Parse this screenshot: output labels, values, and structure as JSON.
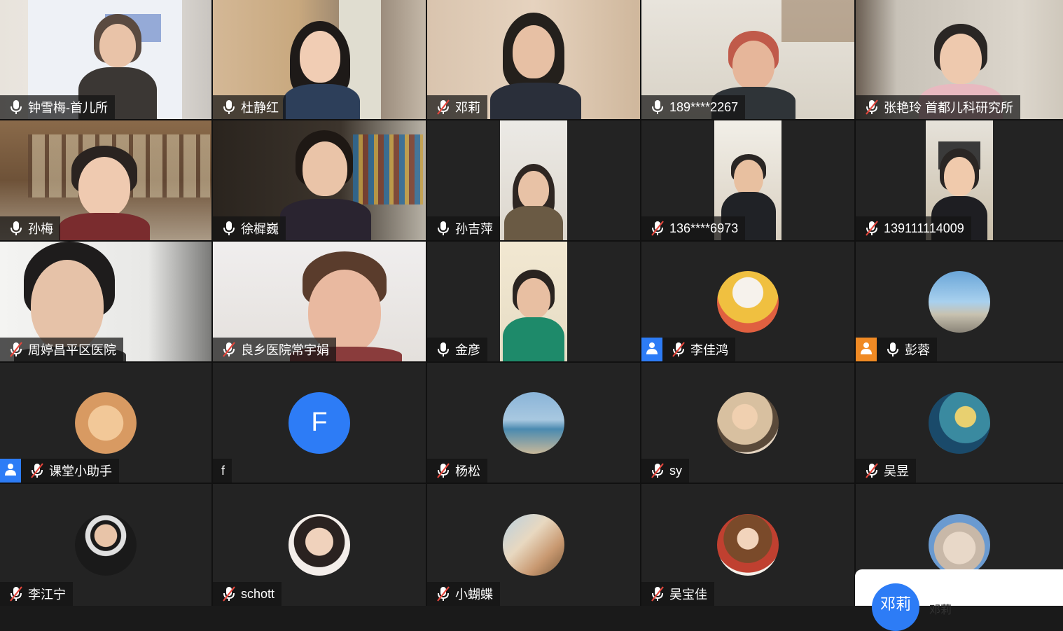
{
  "participants": [
    {
      "name": "钟雪梅-首儿所",
      "mic": "on"
    },
    {
      "name": "杜静红",
      "mic": "on"
    },
    {
      "name": "邓莉",
      "mic": "muted"
    },
    {
      "name": "189****2267",
      "mic": "on"
    },
    {
      "name": "张艳玲  首都儿科研究所",
      "mic": "muted"
    },
    {
      "name": "孙梅",
      "mic": "on"
    },
    {
      "name": "徐樨巍",
      "mic": "on",
      "active_speaker": true
    },
    {
      "name": "孙吉萍",
      "mic": "on"
    },
    {
      "name": "136****6973",
      "mic": "muted"
    },
    {
      "name": "139111114009",
      "mic": "muted"
    },
    {
      "name": "周婷昌平区医院",
      "mic": "muted"
    },
    {
      "name": "良乡医院常宇娟",
      "mic": "muted"
    },
    {
      "name": "金彦",
      "mic": "on"
    },
    {
      "name": "李佳鸿",
      "mic": "muted",
      "badge": "blue"
    },
    {
      "name": "彭蓉",
      "mic": "on",
      "badge": "orange"
    },
    {
      "name": "课堂小助手",
      "mic": "muted",
      "badge": "blue"
    },
    {
      "name": "f",
      "mic": "none",
      "avatar_letter": "F"
    },
    {
      "name": "杨松",
      "mic": "muted"
    },
    {
      "name": "sy",
      "mic": "muted"
    },
    {
      "name": "吴昱",
      "mic": "muted"
    },
    {
      "name": "李江宁",
      "mic": "muted"
    },
    {
      "name": "schott",
      "mic": "muted"
    },
    {
      "name": "小蝴蝶",
      "mic": "muted"
    },
    {
      "name": "吴宝佳",
      "mic": "muted"
    },
    {
      "name": "",
      "mic": "none"
    }
  ],
  "popup": {
    "avatar_text": "邓莉",
    "name": "邓莉"
  },
  "colors": {
    "active_border": "#3fc04f",
    "host_blue": "#2d7cf6",
    "host_orange": "#f08a24"
  },
  "icons": {
    "mic_on": "microphone-icon",
    "mic_muted": "microphone-muted-icon",
    "host": "user-icon"
  }
}
